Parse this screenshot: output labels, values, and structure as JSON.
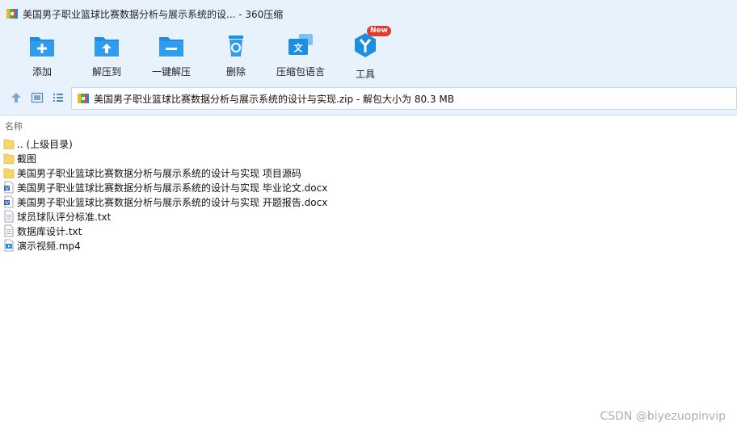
{
  "window": {
    "title": "美国男子职业篮球比赛数据分析与展示系统的设... - 360压缩"
  },
  "toolbar": {
    "items": [
      {
        "label": "添加",
        "icon": "add-icon"
      },
      {
        "label": "解压到",
        "icon": "extract-to-icon"
      },
      {
        "label": "一键解压",
        "icon": "one-click-extract-icon"
      },
      {
        "label": "删除",
        "icon": "delete-icon"
      },
      {
        "label": "压缩包语言",
        "icon": "language-icon"
      },
      {
        "label": "工具",
        "icon": "tools-icon",
        "badge": "New"
      }
    ]
  },
  "address": {
    "path": "美国男子职业篮球比赛数据分析与展示系统的设计与实现.zip - 解包大小为 80.3 MB"
  },
  "list": {
    "column_name": "名称",
    "rows": [
      {
        "name": ".. (上级目录)",
        "type": "folder"
      },
      {
        "name": "截图",
        "type": "folder"
      },
      {
        "name": "美国男子职业篮球比赛数据分析与展示系统的设计与实现 项目源码",
        "type": "folder"
      },
      {
        "name": "美国男子职业篮球比赛数据分析与展示系统的设计与实现 毕业论文.docx",
        "type": "docx"
      },
      {
        "name": "美国男子职业篮球比赛数据分析与展示系统的设计与实现 开题报告.docx",
        "type": "docx"
      },
      {
        "name": "球员球队评分标准.txt",
        "type": "txt"
      },
      {
        "name": "数据库设计.txt",
        "type": "txt"
      },
      {
        "name": "演示视频.mp4",
        "type": "mp4"
      }
    ]
  },
  "watermark": "CSDN @biyezuopinvip",
  "colors": {
    "toolbar_bg": "#e8f2fc",
    "icon_blue": "#1e8fe0",
    "folder_yellow": "#f7d56b",
    "badge_red": "#e23a2c"
  }
}
